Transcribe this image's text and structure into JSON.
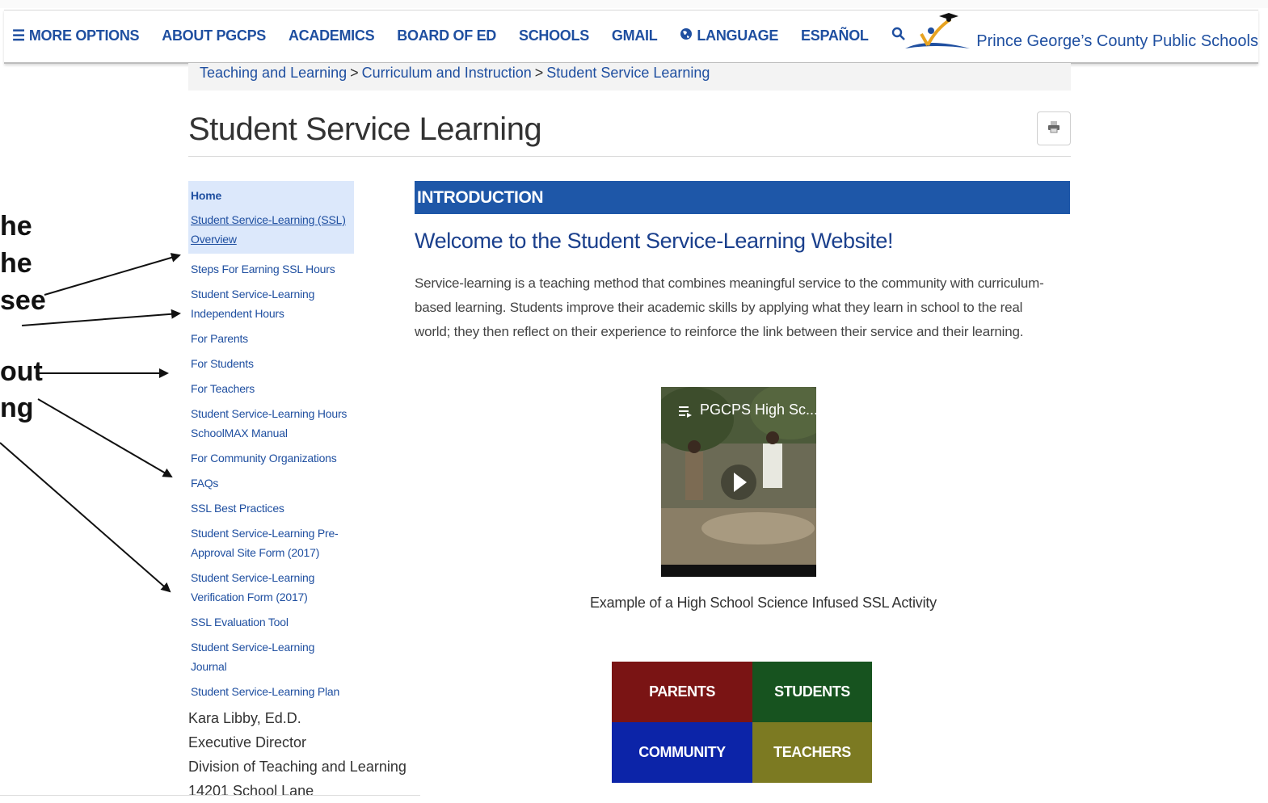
{
  "nav": {
    "more_options": "MORE OPTIONS",
    "about": "ABOUT PGCPS",
    "academics": "ACADEMICS",
    "board": "BOARD OF ED",
    "schools": "SCHOOLS",
    "gmail": "GMAIL",
    "language": "LANGUAGE",
    "espanol": "ESPAÑOL",
    "icons": {
      "menu": "menu-icon",
      "globe": "globe-icon",
      "search": "search-icon"
    }
  },
  "brand": {
    "name": "Prince George’s County Public Schools"
  },
  "breadcrumb": {
    "items": [
      "Teaching and Learning",
      "Curriculum and Instruction",
      "Student Service Learning"
    ],
    "separator": ">"
  },
  "page": {
    "title": "Student Service Learning"
  },
  "sidebar": {
    "home": "Home",
    "overview": "Student Service-Learning (SSL) Overview",
    "items": [
      "Steps For Earning SSL Hours",
      "Student Service-Learning Independent Hours",
      "For Parents",
      "For Students",
      "For Teachers",
      "Student Service-Learning Hours SchoolMAX Manual",
      "For Community Organizations",
      "FAQs",
      "SSL Best Practices",
      "Student Service-Learning Pre-Approval Site Form (2017)",
      "Student Service-Learning Verification Form (2017)",
      "SSL Evaluation Tool",
      "Student Service-Learning Journal",
      "Student Service-Learning Plan"
    ]
  },
  "contact": {
    "name": "Kara Libby, Ed.D.",
    "role": "Executive Director",
    "division": "Division of Teaching and Learning",
    "address": "14201 School Lane"
  },
  "main": {
    "section_header": "INTRODUCTION",
    "welcome": "Welcome to the Student Service-Learning Website!",
    "intro": "Service-learning is a teaching method that combines meaningful service to the community with curriculum-based learning. Students improve their academic skills by applying what they learn in school to the real world; they then reflect on their experience to reinforce the link between their service and their learning.",
    "video_title": "PGCPS High Sc...",
    "video_caption": "Example of a High School Science Infused SSL Activity",
    "tiles": {
      "parents": "PARENTS",
      "students": "STUDENTS",
      "community": "COMMUNITY",
      "teachers": "TEACHERS"
    }
  },
  "colors": {
    "brand_blue": "#1f4fa0",
    "intro_bar": "#1e57a8",
    "parents": "#7a1414",
    "students": "#17531f",
    "community": "#0c24a8",
    "teachers": "#7c7a22"
  },
  "annotation": {
    "fragments": [
      "he",
      "he",
      "see",
      "out",
      "ng"
    ]
  }
}
